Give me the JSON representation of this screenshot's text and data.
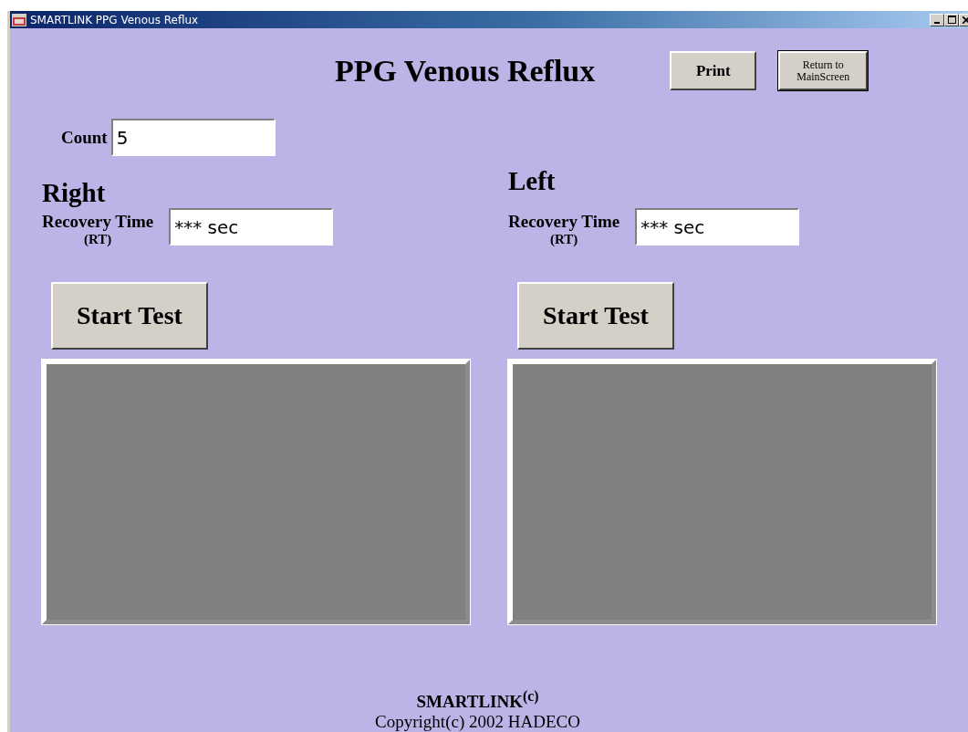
{
  "window": {
    "title": "SMARTLINK PPG Venous Reflux"
  },
  "heading": "PPG Venous Reflux",
  "header_buttons": [
    {
      "label": "Print",
      "focused": false
    },
    {
      "label": "Return to MainScreen",
      "focused": true
    }
  ],
  "count": {
    "label": "Count",
    "value": "5"
  },
  "sides": [
    {
      "title": "Right",
      "recovery_label": "Recovery Time",
      "recovery_abbr": "(RT)",
      "recovery_value": "*** sec",
      "button": "Start Test"
    },
    {
      "title": "Left",
      "recovery_label": "Recovery Time",
      "recovery_abbr": "(RT)",
      "recovery_value": "*** sec",
      "button": "Start Test"
    }
  ],
  "footer": {
    "product": "SMARTLINK$^{(c)}$",
    "copyright": "Copyright(c) 2002 HADECO"
  }
}
